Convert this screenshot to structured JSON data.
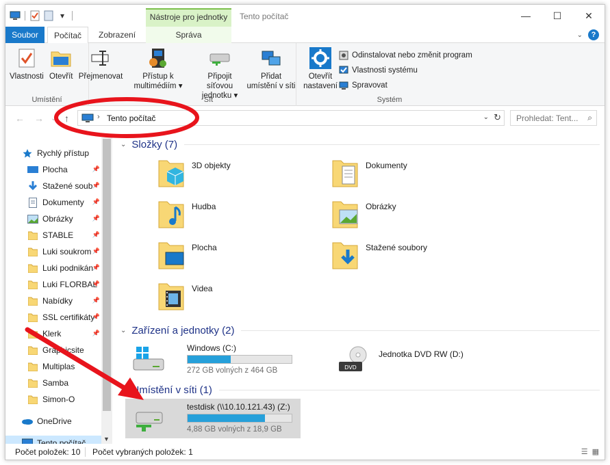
{
  "window": {
    "title": "Tento počítač",
    "context_tab_title": "Nástroje pro jednotky",
    "minimize": "—",
    "maximize": "☐",
    "close": "✕"
  },
  "ribbon_tabs": {
    "file": "Soubor",
    "computer": "Počítač",
    "view": "Zobrazení",
    "manage": "Správa"
  },
  "ribbon": {
    "location": {
      "label": "Umístění",
      "properties": "Vlastnosti",
      "open": "Otevřít",
      "rename": "Přejmenovat"
    },
    "network": {
      "label": "Síť",
      "media_access_line1": "Přístup k",
      "media_access_line2": "multimédiím",
      "map_drive_line1": "Připojit síťovou",
      "map_drive_line2": "jednotku",
      "add_location_line1": "Přidat",
      "add_location_line2": "umístění v síti"
    },
    "system": {
      "label": "Systém",
      "open_settings_line1": "Otevřít",
      "open_settings_line2": "nastavení",
      "uninstall": "Odinstalovat nebo změnit program",
      "system_properties": "Vlastnosti systému",
      "manage": "Spravovat"
    }
  },
  "address": {
    "breadcrumb": "Tento počítač",
    "search_placeholder": "Prohledat: Tent..."
  },
  "nav": {
    "items": [
      {
        "label": "Rychlý přístup",
        "icon": "star-icon"
      },
      {
        "label": "Plocha",
        "icon": "desktop-icon",
        "pinned": true
      },
      {
        "label": "Stažené soub",
        "icon": "download-icon",
        "pinned": true
      },
      {
        "label": "Dokumenty",
        "icon": "document-icon",
        "pinned": true
      },
      {
        "label": "Obrázky",
        "icon": "pictures-icon",
        "pinned": true
      },
      {
        "label": "STABLE",
        "icon": "folder-icon",
        "pinned": true
      },
      {
        "label": "Luki soukrom",
        "icon": "folder-icon",
        "pinned": true
      },
      {
        "label": "Luki podnikán",
        "icon": "folder-icon",
        "pinned": true
      },
      {
        "label": "Luki FLORBAL",
        "icon": "folder-icon",
        "pinned": true
      },
      {
        "label": "Nabídky",
        "icon": "folder-icon",
        "pinned": true
      },
      {
        "label": "SSL certifikáty",
        "icon": "folder-icon",
        "pinned": true
      },
      {
        "label": "Klerk",
        "icon": "folder-icon",
        "pinned": true
      },
      {
        "label": "Graphicsite",
        "icon": "folder-icon"
      },
      {
        "label": "Multiplas",
        "icon": "folder-icon"
      },
      {
        "label": "Samba",
        "icon": "folder-icon"
      },
      {
        "label": "Simon-O",
        "icon": "folder-icon"
      },
      {
        "label": "OneDrive",
        "icon": "onedrive-icon"
      },
      {
        "label": "Tento počítač",
        "icon": "computer-icon"
      }
    ]
  },
  "sections": {
    "folders": "Složky (7)",
    "devices": "Zařízení a jednotky (2)",
    "network": "Umístění v síti (1)"
  },
  "folders": [
    {
      "label": "3D objekty",
      "icon": "3d-objects-folder-icon"
    },
    {
      "label": "Dokumenty",
      "icon": "documents-folder-icon"
    },
    {
      "label": "Hudba",
      "icon": "music-folder-icon"
    },
    {
      "label": "Obrázky",
      "icon": "pictures-folder-icon"
    },
    {
      "label": "Plocha",
      "icon": "desktop-folder-icon"
    },
    {
      "label": "Stažené soubory",
      "icon": "downloads-folder-icon"
    },
    {
      "label": "Videa",
      "icon": "videos-folder-icon"
    }
  ],
  "drives": [
    {
      "name": "Windows (C:)",
      "free": "272 GB volných z 464 GB",
      "used_fraction": 0.414
    },
    {
      "name": "Jednotka DVD RW (D:)"
    }
  ],
  "network_drives": [
    {
      "name": "testdisk (\\\\10.10.121.43) (Z:)",
      "free": "4,88 GB volných z 18,9 GB",
      "used_fraction": 0.742
    }
  ],
  "status": {
    "item_count": "Počet položek: 10",
    "selected_count": "Počet vybraných položek: 1"
  },
  "colors": {
    "accent": "#1979ca",
    "context_tab": "#d9f2c7",
    "drive_bar": "#26a0da",
    "annotation": "#e8141c"
  }
}
